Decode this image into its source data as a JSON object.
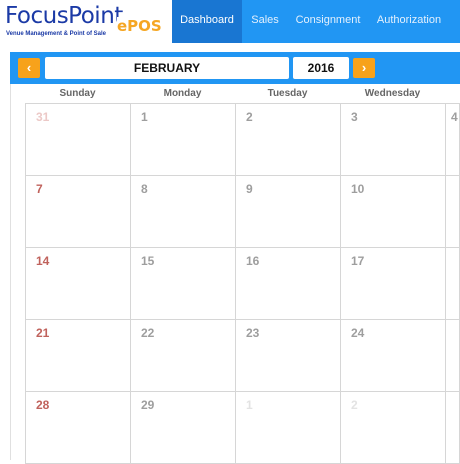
{
  "brand": {
    "name": "FocusPoint",
    "suffix": "ePOS",
    "tagline": "Venue Management & Point of Sale"
  },
  "nav": {
    "items": [
      {
        "label": "Dashboard",
        "active": true
      },
      {
        "label": "Sales",
        "active": false
      },
      {
        "label": "Consignment",
        "active": false
      },
      {
        "label": "Authorization",
        "active": false
      }
    ]
  },
  "calendar": {
    "month": "FEBRUARY",
    "year": "2016",
    "prev_icon": "chevron-left-icon",
    "next_icon": "chevron-right-icon",
    "weekdays": [
      "Sunday",
      "Monday",
      "Tuesday",
      "Wednesday"
    ],
    "weeks": [
      [
        {
          "day": "31",
          "kind": "other-sunday"
        },
        {
          "day": "1",
          "kind": "current"
        },
        {
          "day": "2",
          "kind": "current"
        },
        {
          "day": "3",
          "kind": "current"
        },
        {
          "day": "4",
          "kind": "current"
        }
      ],
      [
        {
          "day": "7",
          "kind": "sunday"
        },
        {
          "day": "8",
          "kind": "current"
        },
        {
          "day": "9",
          "kind": "current"
        },
        {
          "day": "10",
          "kind": "current"
        },
        {
          "day": "",
          "kind": "current"
        }
      ],
      [
        {
          "day": "14",
          "kind": "sunday"
        },
        {
          "day": "15",
          "kind": "current"
        },
        {
          "day": "16",
          "kind": "current"
        },
        {
          "day": "17",
          "kind": "current"
        },
        {
          "day": "",
          "kind": "current"
        }
      ],
      [
        {
          "day": "21",
          "kind": "sunday"
        },
        {
          "day": "22",
          "kind": "current"
        },
        {
          "day": "23",
          "kind": "current"
        },
        {
          "day": "24",
          "kind": "current"
        },
        {
          "day": "",
          "kind": "current"
        }
      ],
      [
        {
          "day": "28",
          "kind": "sunday"
        },
        {
          "day": "29",
          "kind": "current"
        },
        {
          "day": "1",
          "kind": "other"
        },
        {
          "day": "2",
          "kind": "other"
        },
        {
          "day": "",
          "kind": "other"
        }
      ]
    ],
    "colors": {
      "sunday": "#c0625c",
      "other_sunday": "#ecc9c7",
      "current": "#9e9e9e",
      "other": "#e3e3e3",
      "accent": "#2196f3",
      "button": "#f7a21b"
    }
  }
}
